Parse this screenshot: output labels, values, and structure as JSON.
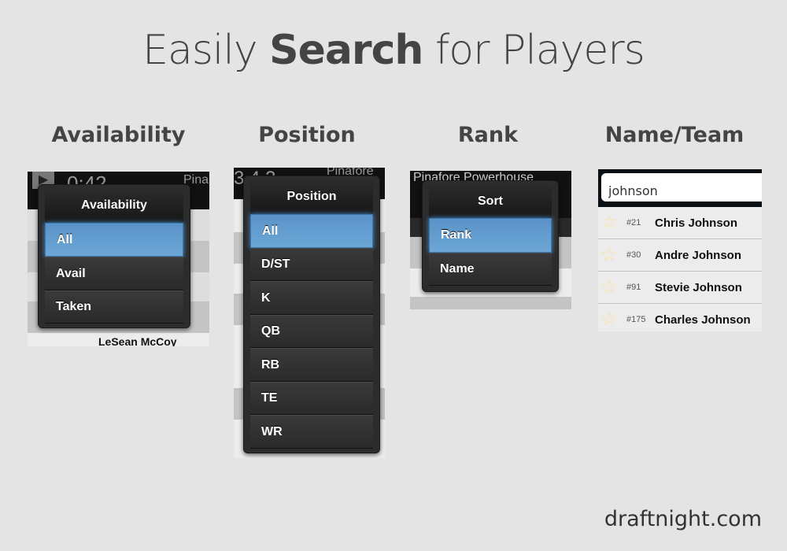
{
  "title": {
    "light1": "Easily ",
    "bold": "Search",
    "light2": " for Players"
  },
  "sections": [
    {
      "heading": "Availability",
      "popup_title": "Availability",
      "options": [
        "All",
        "Avail",
        "Taken"
      ],
      "selected": "All",
      "bg_timer": "0:42",
      "bg_team": "Pina",
      "bg_player": "LeSean McCoy"
    },
    {
      "heading": "Position",
      "popup_title": "Position",
      "options": [
        "All",
        "D/ST",
        "K",
        "QB",
        "RB",
        "TE",
        "WR"
      ],
      "selected": "All",
      "bg_timer": "3 4 2",
      "bg_team": "Pinafore"
    },
    {
      "heading": "Rank",
      "popup_title": "Sort",
      "options": [
        "Rank",
        "Name"
      ],
      "selected": "Rank",
      "bg_team": "Pinafore Powerhouse"
    },
    {
      "heading": "Name/Team",
      "search_value": "johnson",
      "results": [
        {
          "rank": "#21",
          "name": "Chris Johnson"
        },
        {
          "rank": "#30",
          "name": "Andre Johnson"
        },
        {
          "rank": "#91",
          "name": "Stevie Johnson"
        },
        {
          "rank": "#175",
          "name": "Charles Johnson"
        }
      ]
    }
  ],
  "footer": "draftnight.com",
  "colors": {
    "background": "#e4e4e4",
    "selected": "#6ca6d6",
    "popup": "#2c2c2c",
    "star": "#fde0a0"
  },
  "icons": {
    "favorite": "star-outline-icon",
    "play": "play-icon"
  }
}
